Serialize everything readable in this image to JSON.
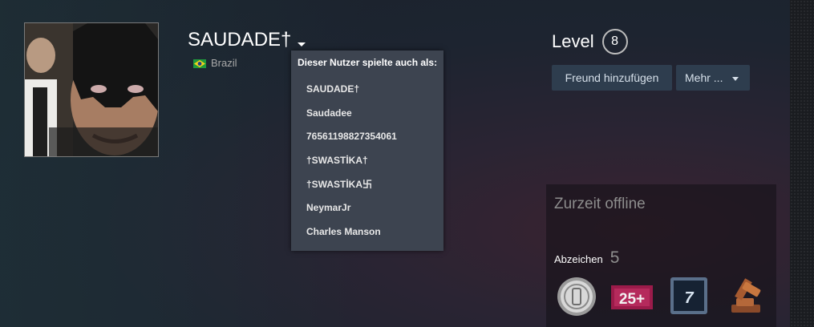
{
  "profile": {
    "persona_name": "SAUDADE†",
    "country": "Brazil"
  },
  "alias_dropdown": {
    "header": "Dieser Nutzer spielte auch als:",
    "items": [
      "SAUDADE†",
      "Saudadee",
      "76561198827354061",
      "†SWASTİKA†",
      "†SWASTİKA卐",
      "NeymarJr",
      "Charles Manson"
    ]
  },
  "level": {
    "label": "Level",
    "value": "8"
  },
  "actions": {
    "add_friend": "Freund hinzufügen",
    "more": "Mehr ..."
  },
  "status_panel": {
    "status": "Zurzeit offline",
    "badges_label": "Abzeichen",
    "badges_count": "5"
  },
  "badge_icons": [
    "silver-coin-icon",
    "years-25-plus-icon",
    "years-7-icon",
    "gavel-icon"
  ],
  "colors": {
    "button_bg": "#2e3d4e",
    "dropdown_bg": "#3d4450",
    "years_badge": "#9b1b4a"
  }
}
